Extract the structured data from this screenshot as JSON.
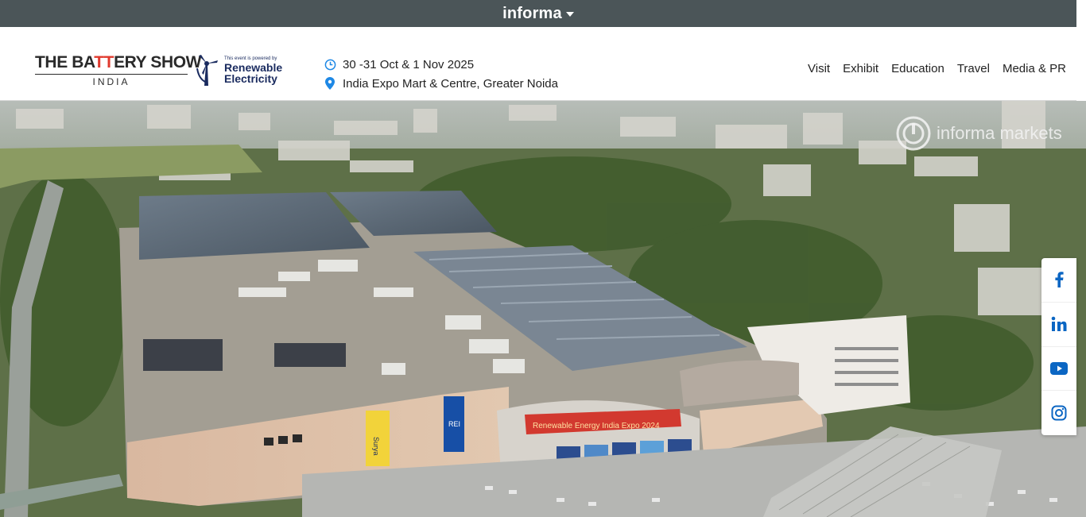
{
  "topbar": {
    "brand": "informa"
  },
  "header": {
    "logo": {
      "title_pre": "THE BA",
      "title_accent": "TT",
      "title_post": "ERY SHOW",
      "subtitle": "INDIA"
    },
    "partner_logo": {
      "small_text": "This event is powered by",
      "line1": "Renewable",
      "line2": "Electricity"
    },
    "date": "30 -31 Oct & 1 Nov 2025",
    "venue": "India Expo Mart & Centre, Greater Noida"
  },
  "nav": {
    "items": [
      "Visit",
      "Exhibit",
      "Education",
      "Travel",
      "Media & PR"
    ]
  },
  "hero": {
    "watermark": "informa markets",
    "signs": {
      "banner": "Renewable Energy India Expo 2024",
      "vertical1": "Surya",
      "vertical2": "REI"
    }
  },
  "social": {
    "items": [
      {
        "name": "facebook-icon",
        "glyph": "f"
      },
      {
        "name": "linkedin-icon",
        "glyph": "in"
      },
      {
        "name": "youtube-icon",
        "glyph": "▶"
      },
      {
        "name": "instagram-icon",
        "glyph": "◎"
      }
    ]
  },
  "colors": {
    "topbar": "#4b5558",
    "accent": "#e03a2e",
    "brand_blue": "#1e88e5",
    "navy": "#1a2b5f"
  }
}
